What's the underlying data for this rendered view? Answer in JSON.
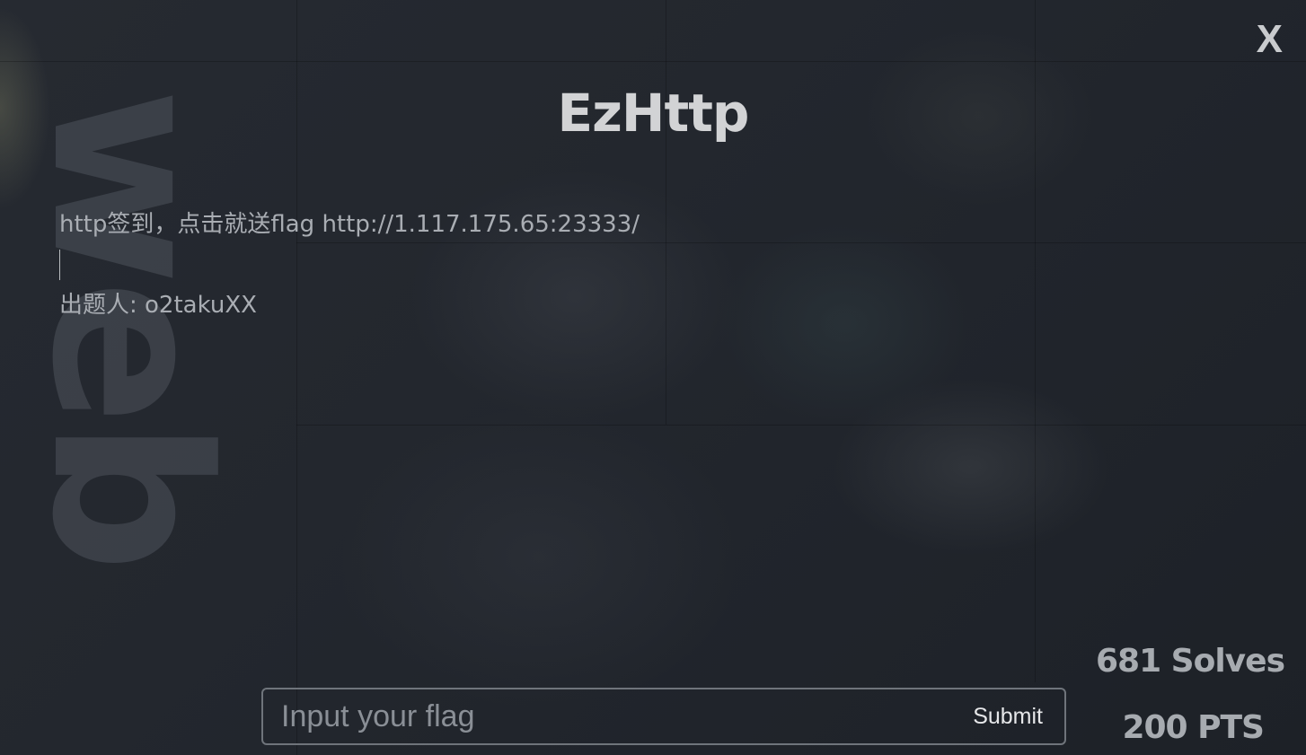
{
  "challenge": {
    "category": "web",
    "title": "EzHttp",
    "description_lines": [
      "http签到，点击就送flag http://1.117.175.65:23333/",
      "出题人: o2takuXX"
    ],
    "solves_text": "681 Solves",
    "points_text": "200 PTS"
  },
  "controls": {
    "close_label": "X",
    "flag_placeholder": "Input your flag",
    "flag_value": "",
    "submit_label": "Submit"
  },
  "colors": {
    "background": "#22262c",
    "title": "#d2d3d5",
    "text": "#a9adb3",
    "input_border": "#6f747b"
  }
}
